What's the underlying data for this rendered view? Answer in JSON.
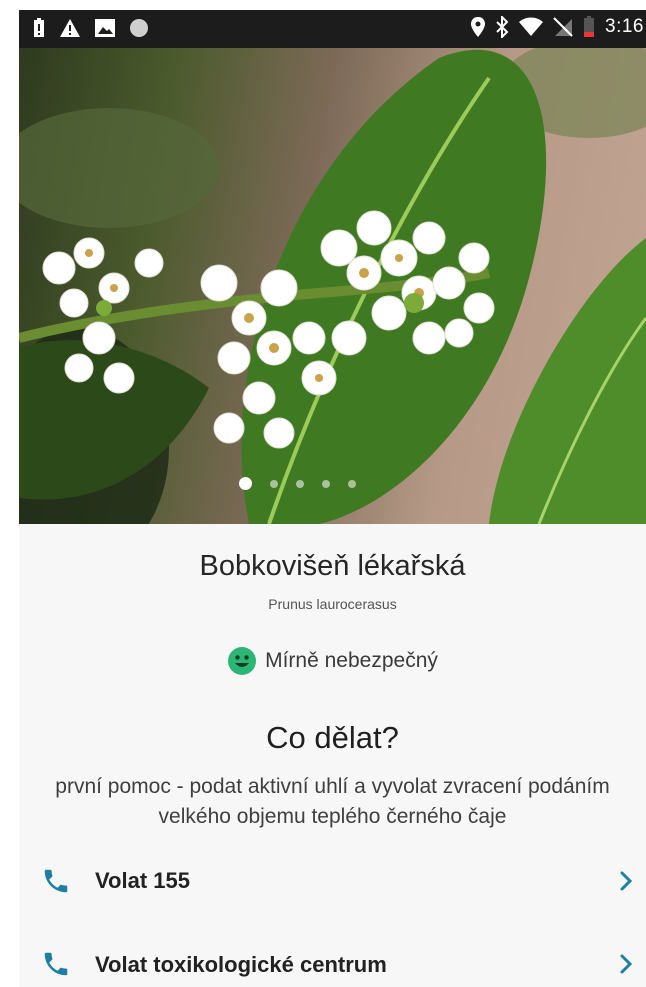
{
  "status_bar": {
    "time": "3:16",
    "left_icons": [
      "battery-alert-icon",
      "warning-icon",
      "image-icon",
      "circle-icon"
    ],
    "right_icons": [
      "location-icon",
      "bluetooth-icon",
      "wifi-icon",
      "no-sim-icon",
      "battery-icon"
    ]
  },
  "gallery": {
    "image": "laurel-cherry-flower-photo",
    "page_count": 5,
    "current_page": 1
  },
  "plant": {
    "name": "Bobkovišeň lékařská",
    "latin_name": "Prunus laurocerasus"
  },
  "danger": {
    "icon": "smiley-face-icon",
    "label": "Mírně nebezpečný",
    "color": "#2bb673"
  },
  "what_to_do": {
    "title": "Co dělat?",
    "text": "první pomoc - podat aktivní uhlí a vyvolat zvracení podáním velkého objemu teplého černého čaje"
  },
  "actions": [
    {
      "icon": "phone-icon",
      "label": "Volat 155",
      "chevron": "chevron-right-icon"
    },
    {
      "icon": "phone-icon",
      "label": "Volat toxikologické centrum",
      "chevron": "chevron-right-icon"
    }
  ],
  "colors": {
    "accent": "#1f7fa3",
    "status_bar": "#1c1c1c"
  }
}
